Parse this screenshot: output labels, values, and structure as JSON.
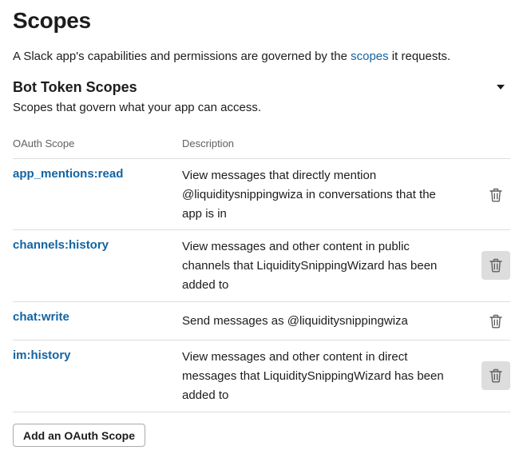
{
  "page": {
    "title": "Scopes",
    "intro_before": "A Slack app's capabilities and permissions are governed by the ",
    "intro_link": "scopes",
    "intro_after": " it requests."
  },
  "section": {
    "title": "Bot Token Scopes",
    "subtitle": "Scopes that govern what your app can access.",
    "collapse_icon": "caret-down-icon"
  },
  "table": {
    "headers": {
      "scope": "OAuth Scope",
      "description": "Description"
    },
    "rows": [
      {
        "scope": "app_mentions:read",
        "description": "View messages that directly mention @liquiditysnippingwiza in conversations that the app is in",
        "delete_icon": "trash-icon",
        "highlighted": false
      },
      {
        "scope": "channels:history",
        "description": "View messages and other content in public channels that LiquiditySnippingWizard has been added to",
        "delete_icon": "trash-icon",
        "highlighted": true
      },
      {
        "scope": "chat:write",
        "description": "Send messages as @liquiditysnippingwiza",
        "delete_icon": "trash-icon",
        "highlighted": false
      },
      {
        "scope": "im:history",
        "description": "View messages and other content in direct messages that LiquiditySnippingWizard has been added to",
        "delete_icon": "trash-icon",
        "highlighted": true
      }
    ]
  },
  "actions": {
    "add_scope_label": "Add an OAuth Scope"
  },
  "colors": {
    "link": "#1264a3",
    "text": "#1d1c1d",
    "muted": "#616061",
    "divider": "#dddddd",
    "hover_bg": "#dddddd"
  }
}
